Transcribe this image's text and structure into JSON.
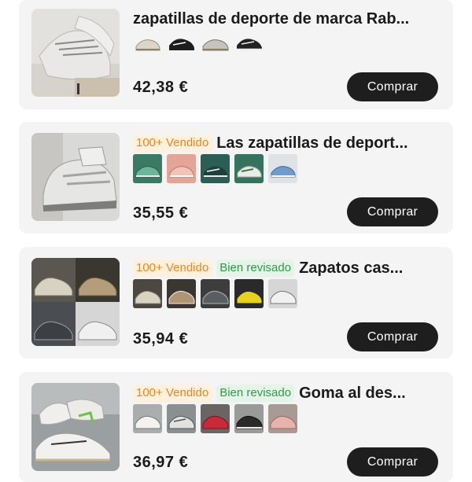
{
  "products": [
    {
      "title": "zapatillas de deporte de marca Rab...",
      "badges": [],
      "price": "42,38 €",
      "buy_label": "Comprar",
      "swatch_icons": [
        "sneaker-beige-icon",
        "sneaker-black-icon",
        "sneaker-grey-icon",
        "sneaker-black-white-icon"
      ]
    },
    {
      "title": "Las zapatillas de deport...",
      "badges": [
        "100+ Vendido"
      ],
      "price": "35,55 €",
      "buy_label": "Comprar",
      "swatch_icons": [
        "sneaker-green-icon",
        "sneaker-pink-icon",
        "sneaker-teal-icon",
        "sneaker-white-green-icon",
        "sneaker-blue-icon"
      ]
    },
    {
      "title": "Zapatos cas...",
      "badges": [
        "100+ Vendido",
        "Bien revisado"
      ],
      "price": "35,94 €",
      "buy_label": "Comprar",
      "swatch_icons": [
        "sneaker-cream-icon",
        "sneaker-brown-icon",
        "sneaker-darkgrey-icon",
        "sneaker-yellow-icon",
        "sneaker-lightgrey-icon"
      ]
    },
    {
      "title": "Goma al des...",
      "badges": [
        "100+ Vendido",
        "Bien revisado"
      ],
      "price": "36,97 €",
      "buy_label": "Comprar",
      "swatch_icons": [
        "sneaker-white-icon",
        "sneaker-grey-white-icon",
        "sneaker-red-icon",
        "sneaker-black-icon",
        "sneaker-pink-icon"
      ]
    }
  ],
  "colors": {
    "card_bg": "#f4f4f4",
    "button_bg": "#1e1e1e",
    "sold_badge": "#e8871d",
    "review_badge": "#2f9a48"
  }
}
